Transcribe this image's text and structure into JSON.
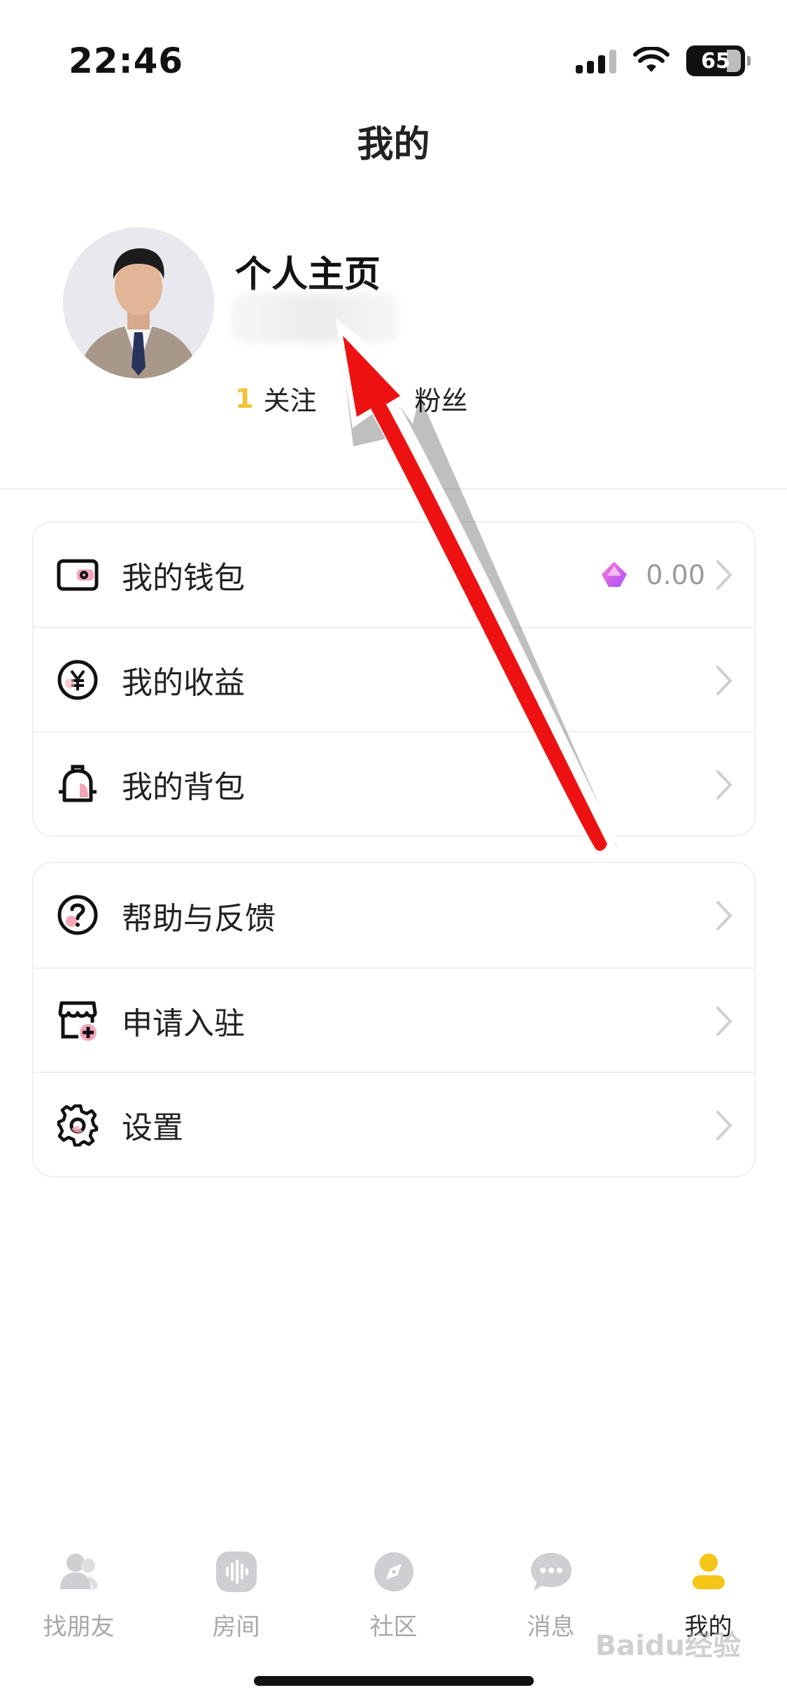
{
  "status_bar": {
    "time": "22:46",
    "battery": "65"
  },
  "header": {
    "title": "我的"
  },
  "profile": {
    "name": "个人主页",
    "following_count": "1",
    "following_label": "关注",
    "followers_label": "粉丝"
  },
  "menu": {
    "group1": [
      {
        "label": "我的钱包",
        "icon": "wallet-icon",
        "value": "0.00"
      },
      {
        "label": "我的收益",
        "icon": "yuan-icon"
      },
      {
        "label": "我的背包",
        "icon": "backpack-icon"
      }
    ],
    "group2": [
      {
        "label": "帮助与反馈",
        "icon": "help-icon"
      },
      {
        "label": "申请入驻",
        "icon": "store-add-icon"
      },
      {
        "label": "设置",
        "icon": "gear-icon"
      }
    ]
  },
  "tab_bar": {
    "items": [
      {
        "label": "找朋友",
        "icon": "friends-icon"
      },
      {
        "label": "房间",
        "icon": "room-audio-icon"
      },
      {
        "label": "社区",
        "icon": "compass-icon"
      },
      {
        "label": "消息",
        "icon": "message-icon"
      },
      {
        "label": "我的",
        "icon": "profile-icon",
        "active": true
      }
    ]
  },
  "watermark": "Baidu经验",
  "colors": {
    "accent_yellow": "#f2c23a",
    "icon_pink": "#f3a6b8",
    "arrow_red": "#ee1111"
  }
}
